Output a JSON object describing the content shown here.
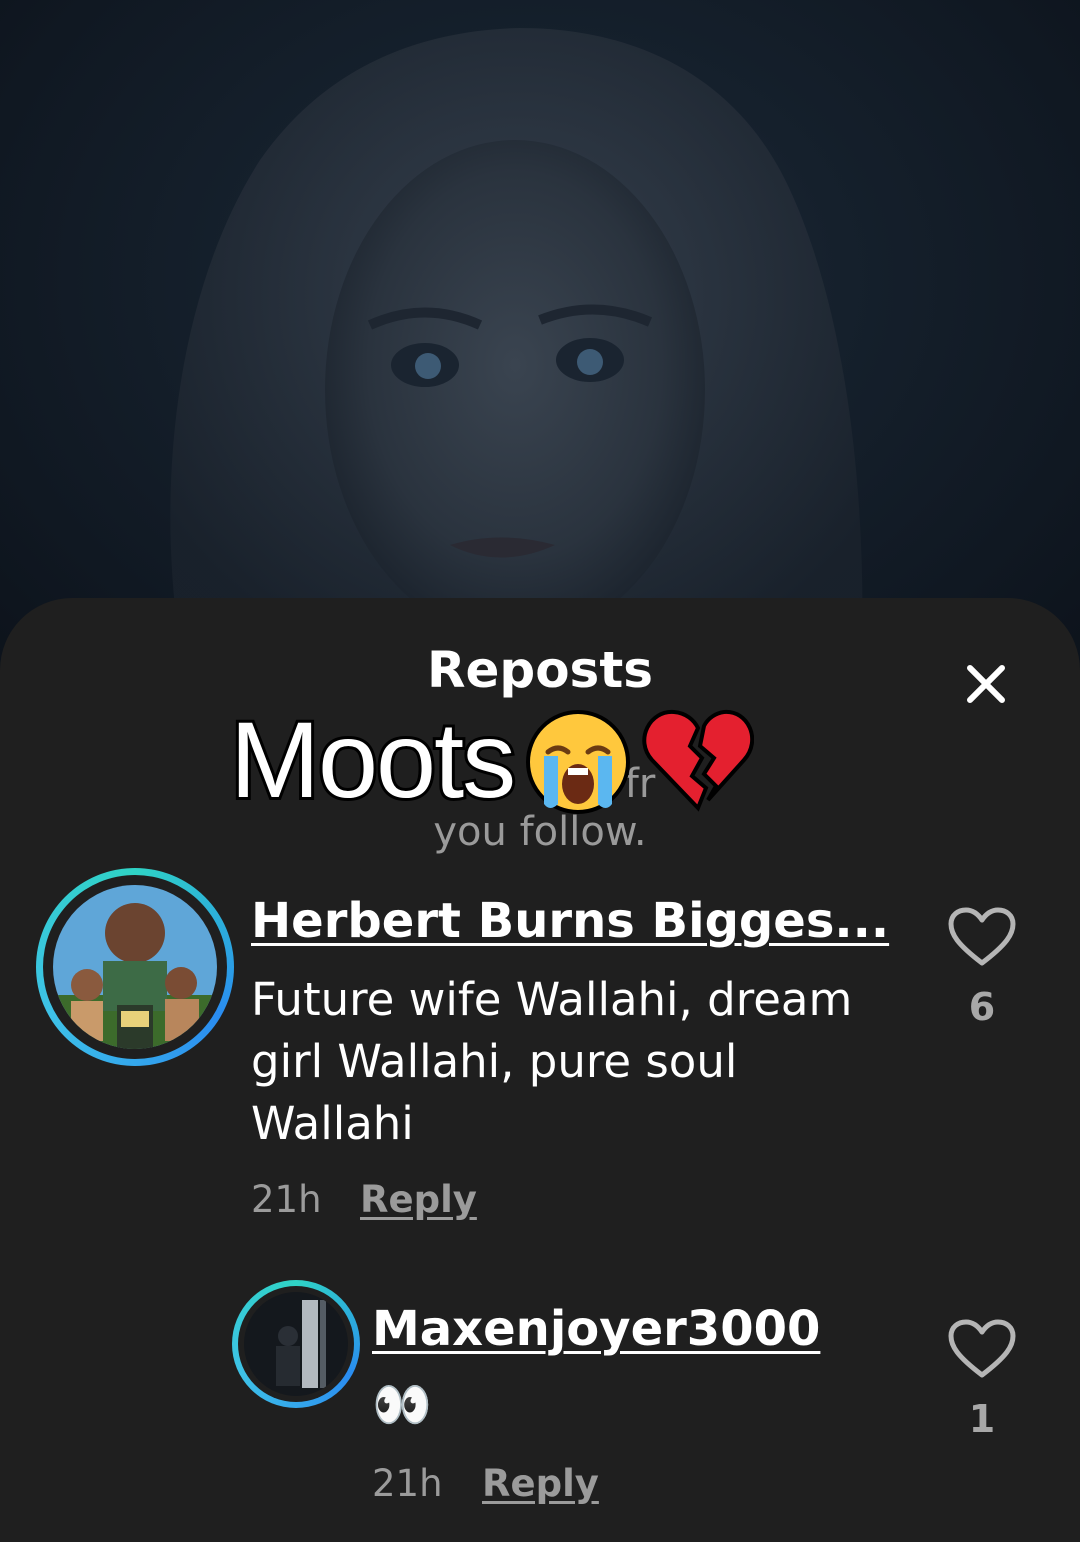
{
  "sheet": {
    "title": "Reposts",
    "subtitle_partial": "fr",
    "subtitle_partial_line2": "you follow.",
    "close_icon": "close-icon"
  },
  "overlay_caption": {
    "text": "Moots",
    "emojis": [
      "loudly-crying-face-emoji",
      "broken-heart-emoji"
    ]
  },
  "comments": [
    {
      "username": "Herbert Burns Bigges...",
      "text": "Future wife Wallahi, dream girl Wallahi, pure soul Wallahi",
      "time": "21h",
      "reply_label": "Reply",
      "likes": "6",
      "like_icon": "heart-outline-icon"
    },
    {
      "username": "Maxenjoyer3000",
      "text": "👀",
      "time": "21h",
      "reply_label": "Reply",
      "likes": "1",
      "like_icon": "heart-outline-icon"
    }
  ]
}
